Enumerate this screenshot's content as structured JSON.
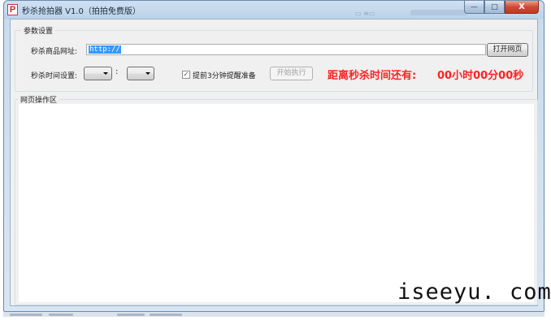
{
  "window": {
    "icon_letter": "P",
    "title": "秒杀抢拍器 V1.0（拍拍免费版）",
    "minimize_glyph": "—",
    "maximize_glyph": "□",
    "close_glyph": "X",
    "title_ghost_text": "▭ ≡▭"
  },
  "settings": {
    "group_title": "参数设置",
    "url_label": "秒杀商品网址:",
    "url_value": "http://",
    "open_button": "打开网页",
    "time_label": "秒杀时间设置:",
    "colon": ":",
    "hour_select_value": "",
    "minute_select_value": "",
    "remind_checked": true,
    "remind_label": "提前3分钟提醒准备",
    "start_button": "开始执行",
    "countdown_label": "距离秒杀时间还有:",
    "countdown_value": "00小时00分00秒"
  },
  "web_panel": {
    "group_title": "网页操作区"
  },
  "watermark": "iseeyu. com",
  "colors": {
    "countdown": "#ff2222",
    "selection": "#3399ff",
    "close_button": "#c0391f"
  }
}
